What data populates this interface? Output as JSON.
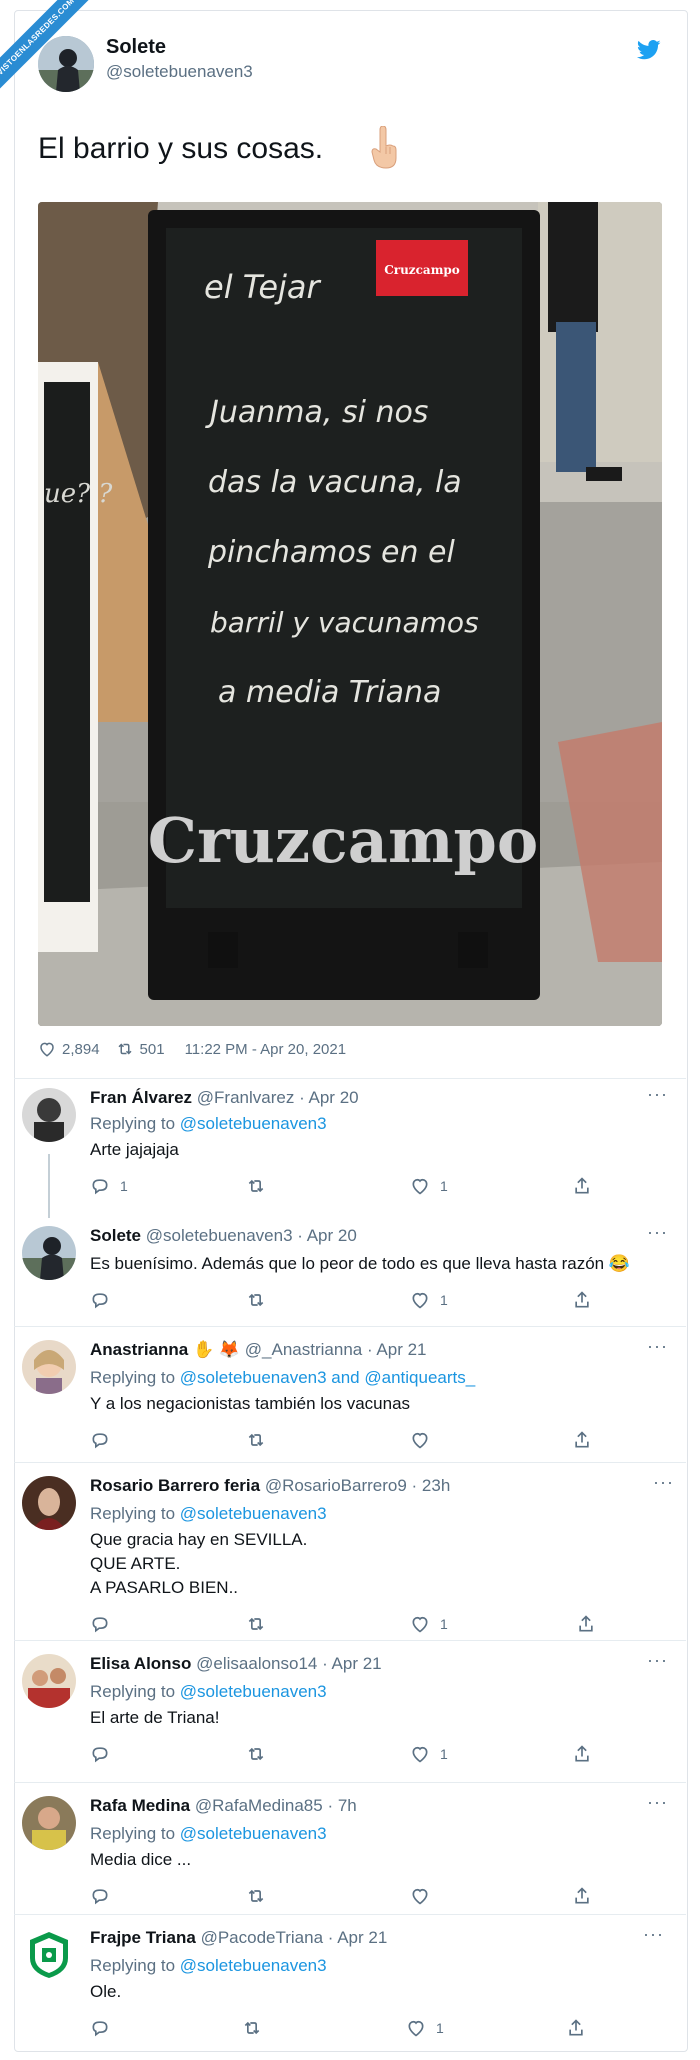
{
  "watermark": "VISTOENLASREDES.COM",
  "tweet": {
    "name": "Solete",
    "handle": "@soletebuenaven3",
    "text": "El barrio y sus cosas.",
    "likes": "2,894",
    "retweets": "501",
    "timestamp": "11:22 PM - Apr 20, 2021"
  },
  "photo": {
    "board_header": "el Tejar",
    "brand_badge": "Cruzcampo",
    "board_lines": [
      "Juanma, si nos",
      "das la vacuna, la",
      "pinchamos en el",
      "barril y vacunamos",
      "a media Triana"
    ],
    "board_footer": "Cruzcampo",
    "side_board_text": "ue? ?"
  },
  "replies": [
    {
      "name": "Fran Álvarez",
      "handle": "@Franlvarez",
      "date": "Apr 20",
      "replying_label": "Replying to",
      "replying_to": "@soletebuenaven3",
      "lines": [
        "Arte jajajaja"
      ],
      "reply_count": "1",
      "like_count": "1"
    },
    {
      "name": "Solete",
      "handle": "@soletebuenaven3",
      "date": "Apr 20",
      "lines": [
        "Es buenísimo. Además que lo peor de todo es que lleva hasta razón 😂"
      ],
      "reply_count": "",
      "like_count": "1"
    },
    {
      "name": "Anastrianna",
      "handle": "@_Anastrianna",
      "date": "Apr 21",
      "replying_label": "Replying to",
      "replying_to": "@soletebuenaven3 and @antiquearts_",
      "lines": [
        "Y a los negacionistas también los vacunas"
      ],
      "reply_count": "",
      "like_count": ""
    },
    {
      "name": "Rosario Barrero feria",
      "handle": "@RosarioBarrero9",
      "date": "23h",
      "replying_label": "Replying to",
      "replying_to": "@soletebuenaven3",
      "lines": [
        "Que gracia hay en SEVILLA.",
        "QUE ARTE.",
        "A PASARLO BIEN.."
      ],
      "reply_count": "",
      "like_count": "1"
    },
    {
      "name": "Elisa Alonso",
      "handle": "@elisaalonso14",
      "date": "Apr 21",
      "replying_label": "Replying to",
      "replying_to": "@soletebuenaven3",
      "lines": [
        "El arte de Triana!"
      ],
      "reply_count": "",
      "like_count": "1"
    },
    {
      "name": "Rafa Medina",
      "handle": "@RafaMedina85",
      "date": "7h",
      "replying_label": "Replying to",
      "replying_to": "@soletebuenaven3",
      "lines": [
        "Media dice ..."
      ],
      "reply_count": "",
      "like_count": ""
    },
    {
      "name": "Frajpe Triana",
      "handle": "@PacodeTriana",
      "date": "Apr 21",
      "replying_label": "Replying to",
      "replying_to": "@soletebuenaven3",
      "lines": [
        "Ole."
      ],
      "reply_count": "",
      "like_count": "1"
    }
  ],
  "colors": {
    "link": "#1b95e0",
    "muted": "#5b7083",
    "brand": "#1da1f2",
    "cruzcampo_red": "#d9232e"
  },
  "icons": [
    "twitter-bird-icon",
    "heart-icon",
    "retweet-icon",
    "reply-icon",
    "share-icon",
    "more-icon",
    "point-down-emoji",
    "tears-of-joy-emoji"
  ]
}
